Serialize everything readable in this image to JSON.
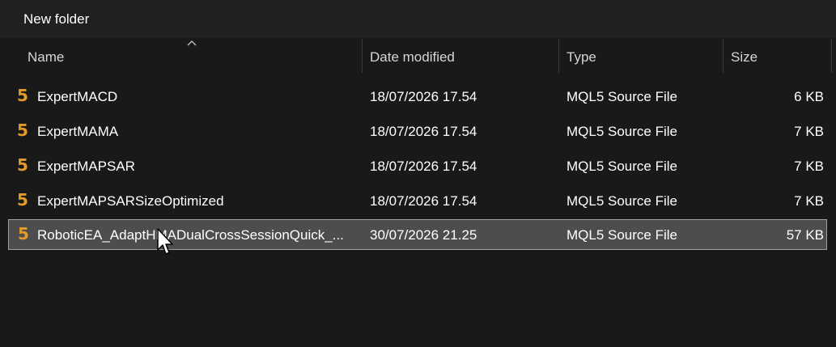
{
  "window": {
    "title": "New folder"
  },
  "colors": {
    "background": "#191919",
    "titlebar": "#202020",
    "selected_row": "#4d4d4d",
    "selected_border": "#a0a0a0",
    "file_icon": "#e39a2b"
  },
  "columns": {
    "name": "Name",
    "date": "Date modified",
    "type": "Type",
    "size": "Size",
    "sort": "ascending-by-name"
  },
  "files": [
    {
      "icon": "5",
      "icon_name": "mql5-file-icon",
      "name": "ExpertMACD",
      "date": "18/07/2026 17.54",
      "type": "MQL5 Source File",
      "size": "6 KB",
      "selected": false
    },
    {
      "icon": "5",
      "icon_name": "mql5-file-icon",
      "name": "ExpertMAMA",
      "date": "18/07/2026 17.54",
      "type": "MQL5 Source File",
      "size": "7 KB",
      "selected": false
    },
    {
      "icon": "5",
      "icon_name": "mql5-file-icon",
      "name": "ExpertMAPSAR",
      "date": "18/07/2026 17.54",
      "type": "MQL5 Source File",
      "size": "7 KB",
      "selected": false
    },
    {
      "icon": "5",
      "icon_name": "mql5-file-icon",
      "name": "ExpertMAPSARSizeOptimized",
      "date": "18/07/2026 17.54",
      "type": "MQL5 Source File",
      "size": "7 KB",
      "selected": false
    },
    {
      "icon": "5",
      "icon_name": "mql5-file-icon",
      "name": "RoboticEA_AdaptHMADualCrossSessionQuick_...",
      "date": "30/07/2026 21.25",
      "type": "MQL5 Source File",
      "size": "57 KB",
      "selected": true
    }
  ]
}
